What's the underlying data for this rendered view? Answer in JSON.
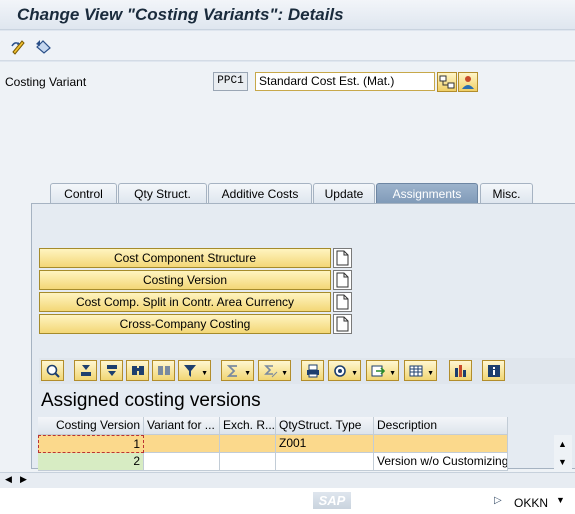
{
  "window": {
    "title": "Change View \"Costing Variants\": Details"
  },
  "toolbar": {
    "icons": [
      "display-change-icon",
      "undo-icon"
    ]
  },
  "header": {
    "costing_variant_label": "Costing Variant",
    "costing_variant_value": "PPC1",
    "costing_variant_desc": "Standard Cost Est. (Mat.)"
  },
  "tabs": [
    {
      "label": "Control",
      "active": false
    },
    {
      "label": "Qty Struct.",
      "active": false
    },
    {
      "label": "Additive Costs",
      "active": false
    },
    {
      "label": "Update",
      "active": false
    },
    {
      "label": "Assignments",
      "active": true
    },
    {
      "label": "Misc.",
      "active": false
    }
  ],
  "assignments": {
    "buttons": [
      "Cost Component Structure",
      "Costing Version",
      "Cost Comp. Split in Contr. Area Currency",
      "Cross-Company Costing"
    ]
  },
  "grid": {
    "title": "Assigned costing versions",
    "columns": [
      "Costing Version",
      "Variant for ...",
      "Exch. R...",
      "QtyStruct. Type",
      "Description"
    ],
    "rows": [
      {
        "costing_version": "1",
        "variant_for": "",
        "exch_rate": "",
        "qty_struct_type": "Z001",
        "description": ""
      },
      {
        "costing_version": "2",
        "variant_for": "",
        "exch_rate": "",
        "qty_struct_type": "",
        "description": "Version w/o Customizing"
      }
    ]
  },
  "status": {
    "system": "OKKN",
    "logo": "SAP"
  },
  "colors": {
    "active_tab": "#8aa4c0",
    "selected_row": "#fbd98c",
    "key_cell": "#d7ecc3",
    "button_yellow": "#f3d777"
  }
}
